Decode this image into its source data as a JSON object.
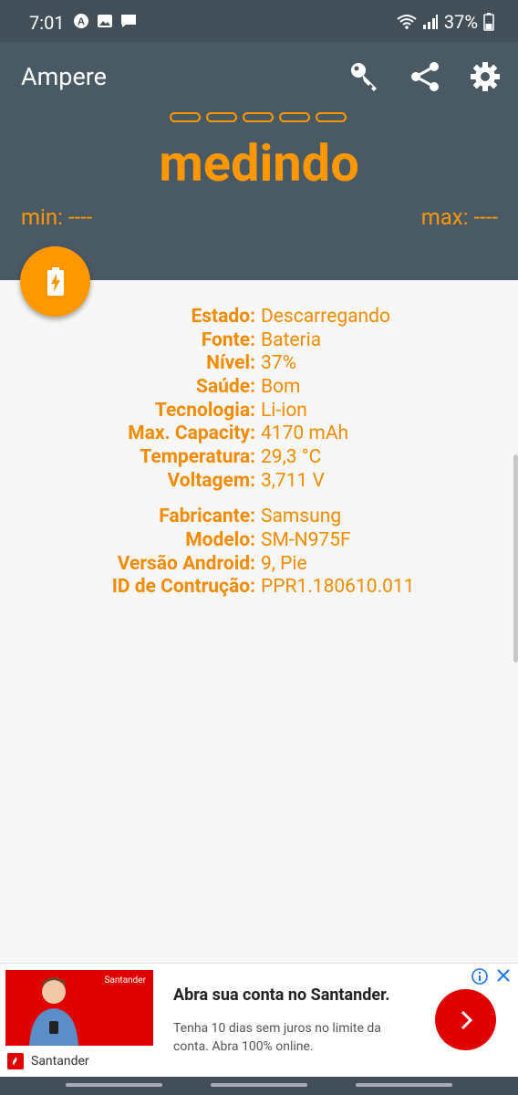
{
  "status_bar": {
    "time": "7:01",
    "battery": "37%"
  },
  "app": {
    "title": "Ampere",
    "reading": "medindo",
    "min": "min: ----",
    "max": "max: ----",
    "actions": [
      "key-icon",
      "share-icon",
      "gear-icon"
    ]
  },
  "colors": {
    "accent": "#ff9800",
    "header": "#4a5a65",
    "statusbar": "#434f58"
  },
  "battery_info": [
    {
      "label": "Estado:",
      "value": "Descarregando"
    },
    {
      "label": "Fonte:",
      "value": "Bateria"
    },
    {
      "label": "Nível:",
      "value": "37%"
    },
    {
      "label": "Saúde:",
      "value": "Bom"
    },
    {
      "label": "Tecnologia:",
      "value": "Li-ion"
    },
    {
      "label": "Max. Capacity:",
      "value": "4170 mAh"
    },
    {
      "label": "Temperatura:",
      "value": "29,3 °C"
    },
    {
      "label": "Voltagem:",
      "value": "3,711 V"
    }
  ],
  "device_info": [
    {
      "label": "Fabricante:",
      "value": "Samsung"
    },
    {
      "label": "Modelo:",
      "value": "SM-N975F"
    },
    {
      "label": "Versão Android:",
      "value": "9, Pie"
    },
    {
      "label": "ID de Contrução:",
      "value": "PPR1.180610.011"
    }
  ],
  "ad": {
    "brand": "Santander",
    "brand_small": "Santander",
    "title": "Abra sua conta no Santander.",
    "text": "Tenha 10 dias sem juros no limite da conta. Abra 100% online."
  }
}
